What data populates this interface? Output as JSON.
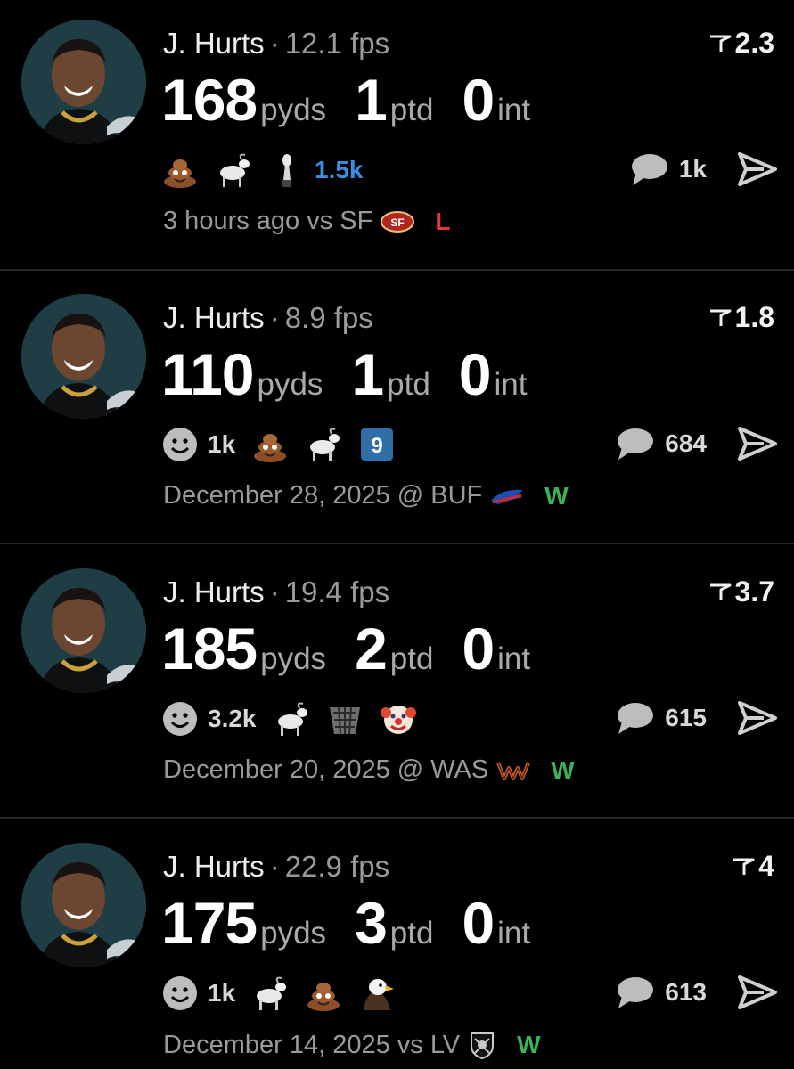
{
  "posts": [
    {
      "player": "J. Hurts",
      "fps": "12.1 fps",
      "rating": "2.3",
      "stats": [
        {
          "value": "168",
          "unit": "pyds"
        },
        {
          "value": "1",
          "unit": "ptd"
        },
        {
          "value": "0",
          "unit": "int"
        }
      ],
      "reactions": [
        {
          "icon": "poop-emoji-icon"
        },
        {
          "icon": "goat-emoji-icon"
        },
        {
          "icon": "trophy-icon"
        }
      ],
      "reaction_count": "1.5k",
      "comment_count": "1k",
      "time": "3 hours ago vs SF",
      "opponent_logo": "49ers-logo-icon",
      "result": "L",
      "result_color": "#e0383e"
    },
    {
      "player": "J. Hurts",
      "fps": "8.9 fps",
      "rating": "1.8",
      "stats": [
        {
          "value": "110",
          "unit": "pyds"
        },
        {
          "value": "1",
          "unit": "ptd"
        },
        {
          "value": "0",
          "unit": "int"
        }
      ],
      "reactions": [
        {
          "icon": "smiley-icon",
          "count": "1k"
        },
        {
          "icon": "poop-emoji-icon"
        },
        {
          "icon": "goat-emoji-icon"
        },
        {
          "icon": "number-9-badge-icon"
        }
      ],
      "comment_count": "684",
      "time": "December 28, 2025 @ BUF",
      "opponent_logo": "bills-logo-icon",
      "result": "W",
      "result_color": "#3cb25a"
    },
    {
      "player": "J. Hurts",
      "fps": "19.4 fps",
      "rating": "3.7",
      "stats": [
        {
          "value": "185",
          "unit": "pyds"
        },
        {
          "value": "2",
          "unit": "ptd"
        },
        {
          "value": "0",
          "unit": "int"
        }
      ],
      "reactions": [
        {
          "icon": "smiley-icon",
          "count": "3.2k"
        },
        {
          "icon": "goat-emoji-icon"
        },
        {
          "icon": "basket-icon"
        },
        {
          "icon": "clown-emoji-icon"
        }
      ],
      "comment_count": "615",
      "time": "December 20, 2025 @ WAS",
      "opponent_logo": "commanders-logo-icon",
      "result": "W",
      "result_color": "#3cb25a"
    },
    {
      "player": "J. Hurts",
      "fps": "22.9 fps",
      "rating": "4",
      "stats": [
        {
          "value": "175",
          "unit": "pyds"
        },
        {
          "value": "3",
          "unit": "ptd"
        },
        {
          "value": "0",
          "unit": "int"
        }
      ],
      "reactions": [
        {
          "icon": "smiley-icon",
          "count": "1k"
        },
        {
          "icon": "goat-emoji-icon"
        },
        {
          "icon": "poop-emoji-icon"
        },
        {
          "icon": "eagle-emoji-icon"
        }
      ],
      "comment_count": "613",
      "time": "December 14, 2025 vs LV",
      "opponent_logo": "raiders-logo-icon",
      "result": "W",
      "result_color": "#3cb25a"
    }
  ],
  "colors": {
    "background": "#000000",
    "muted": "#9a9a9a",
    "reaction_blue": "#3a8de0",
    "win": "#3cb25a",
    "loss": "#e0383e"
  }
}
